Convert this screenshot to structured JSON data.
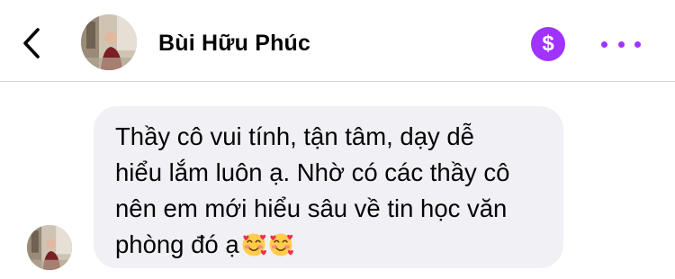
{
  "header": {
    "back_icon": "chevron-left-icon",
    "contact_name": "Bùi Hữu Phúc",
    "pay_symbol": "$",
    "more_icon": "more-dots-icon"
  },
  "message": {
    "lines": [
      "Thầy cô vui tính, tận tâm, dạy dễ",
      "hiểu lắm luôn ạ. Nhờ có các thầy cô",
      "nên em mới hiểu sâu về tin học văn",
      "phòng đó ạ"
    ],
    "emojis": [
      "smiling-face-with-hearts-icon",
      "smiling-face-with-hearts-icon"
    ]
  },
  "colors": {
    "accent": "#a033ff",
    "bubble": "#f0f0f5",
    "divider": "#d7d7d9"
  }
}
